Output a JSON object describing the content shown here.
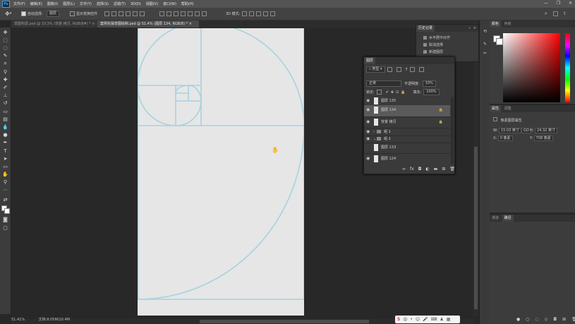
{
  "menubar": {
    "logo": "Ps",
    "items": [
      "文件(F)",
      "编辑(E)",
      "图像(I)",
      "图层(L)",
      "文字(Y)",
      "选择(S)",
      "滤镜(T)",
      "3D(D)",
      "视图(V)",
      "窗口(W)",
      "帮助(H)"
    ]
  },
  "options": {
    "auto_select_label": "自动选择:",
    "auto_select_value": "图层",
    "show_transform_label": "显示变换控件",
    "mode_label": "3D 模式:"
  },
  "tabs": [
    {
      "label": "草图构思.psd @ 33.3% (背景 拷贝, RGB/8#) *",
      "close": "×"
    },
    {
      "label": "案例实操草图绘制.psd @ 51.4% (图层 134, RGB/8) *",
      "close": "×"
    }
  ],
  "status": {
    "zoom": "51.41%",
    "doc": "文档:8.05M/10.4M"
  },
  "history": {
    "header": "历史记录",
    "items": [
      "水平居中对齐",
      "取消选择",
      "新建图层"
    ]
  },
  "layers": {
    "header": "图层",
    "filter_label": "类型",
    "blend_mode": "正常",
    "opacity_label": "不透明度:",
    "opacity_value": "33%",
    "lock_label": "锁定:",
    "fill_label": "填充:",
    "fill_value": "100%",
    "rows": [
      {
        "name": "图层 135",
        "visible": true,
        "selected": false,
        "locked": false
      },
      {
        "name": "图层 134",
        "visible": true,
        "selected": true,
        "locked": true
      },
      {
        "name": "背景 拷贝",
        "visible": true,
        "selected": false,
        "locked": true
      },
      {
        "name": "组 1",
        "visible": true,
        "selected": false,
        "locked": false
      },
      {
        "name": "组 2",
        "visible": true,
        "selected": false,
        "locked": false
      },
      {
        "name": "图层 133",
        "visible": false,
        "selected": false,
        "locked": false
      },
      {
        "name": "图层 124",
        "visible": true,
        "selected": false,
        "locked": false
      }
    ]
  },
  "color_panel": {
    "tabs": [
      "颜色",
      "色板"
    ],
    "fg": "#ffffff",
    "bg": "#ffffff"
  },
  "properties": {
    "tabs": [
      "属性",
      "调整"
    ],
    "kind": "像素图层属性",
    "w_label": "W:",
    "w_value": "15.03 英寸",
    "link": "GO",
    "h_label": "H:",
    "h_value": "24.32 英寸",
    "x_label": "X:",
    "x_value": "0 像素",
    "y_label": "Y:",
    "y_value": "708 像素"
  },
  "paths_panel": {
    "tabs": [
      "通道",
      "路径"
    ]
  },
  "accent": "#a7d2e0"
}
